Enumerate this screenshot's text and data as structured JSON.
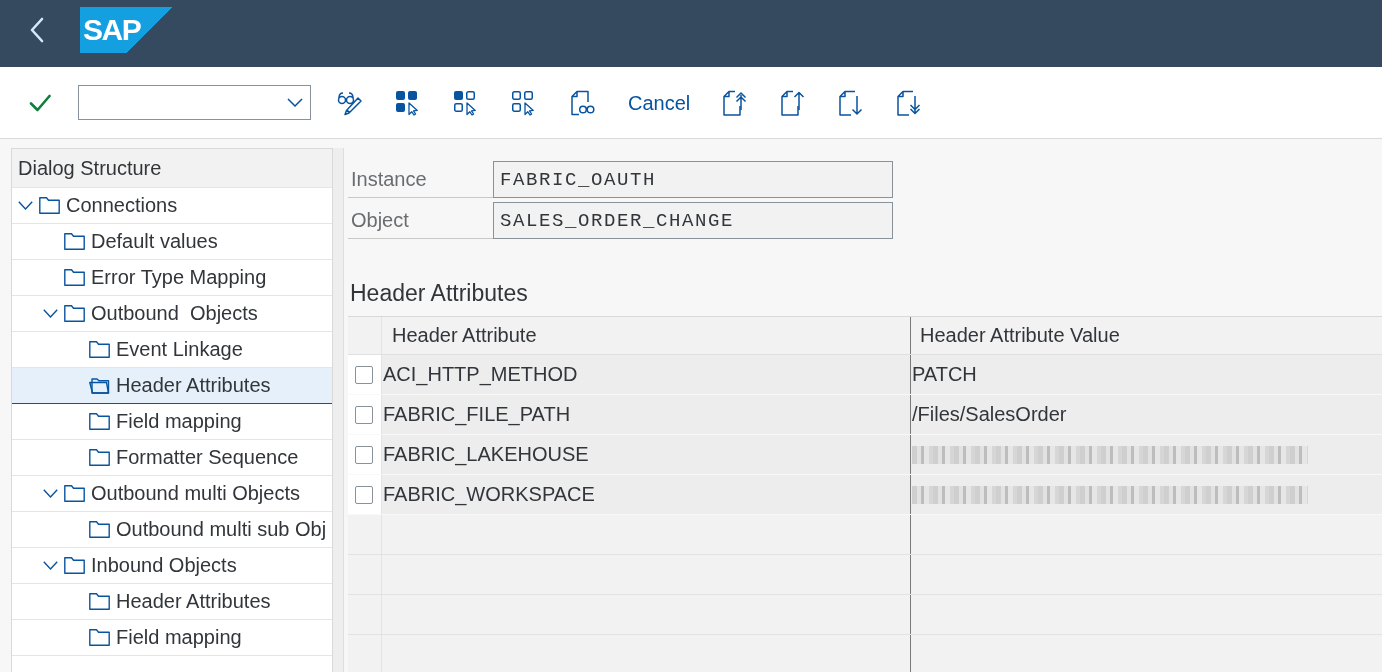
{
  "shell": {
    "logo": "SAP"
  },
  "toolbar": {
    "cancel": "Cancel"
  },
  "tree": {
    "title": "Dialog Structure",
    "items": [
      {
        "label": "Connections",
        "selected": false,
        "expanded": true,
        "children": [
          {
            "label": "Default values",
            "selected": false
          },
          {
            "label": "Error Type Mapping",
            "selected": false
          },
          {
            "label": "Outbound  Objects",
            "selected": false,
            "expanded": true,
            "children": [
              {
                "label": "Event Linkage",
                "selected": false
              },
              {
                "label": "Header Attributes",
                "selected": true
              },
              {
                "label": "Field mapping",
                "selected": false
              },
              {
                "label": "Formatter Sequence",
                "selected": false
              }
            ]
          },
          {
            "label": "Outbound multi Objects",
            "selected": false,
            "expanded": true,
            "children": [
              {
                "label": "Outbound multi sub Obj",
                "selected": false
              }
            ]
          },
          {
            "label": "Inbound Objects",
            "selected": false,
            "expanded": true,
            "children": [
              {
                "label": "Header Attributes",
                "selected": false
              },
              {
                "label": "Field mapping",
                "selected": false
              }
            ]
          }
        ]
      }
    ]
  },
  "form": {
    "fields": [
      {
        "label": "Instance",
        "value": "FABRIC_OAUTH"
      },
      {
        "label": "Object",
        "value": "SALES_ORDER_CHANGE"
      }
    ]
  },
  "table": {
    "title": "Header Attributes",
    "columns": [
      "Header Attribute",
      "Header Attribute Value"
    ],
    "rows": [
      {
        "checked": false,
        "attribute": "ACI_HTTP_METHOD",
        "redacted": false,
        "value": "PATCH"
      },
      {
        "checked": false,
        "attribute": "FABRIC_FILE_PATH",
        "redacted": false,
        "value": "/Files/SalesOrder"
      },
      {
        "checked": false,
        "attribute": "FABRIC_LAKEHOUSE",
        "redacted": true
      },
      {
        "checked": false,
        "attribute": "FABRIC_WORKSPACE",
        "redacted": true
      }
    ]
  }
}
